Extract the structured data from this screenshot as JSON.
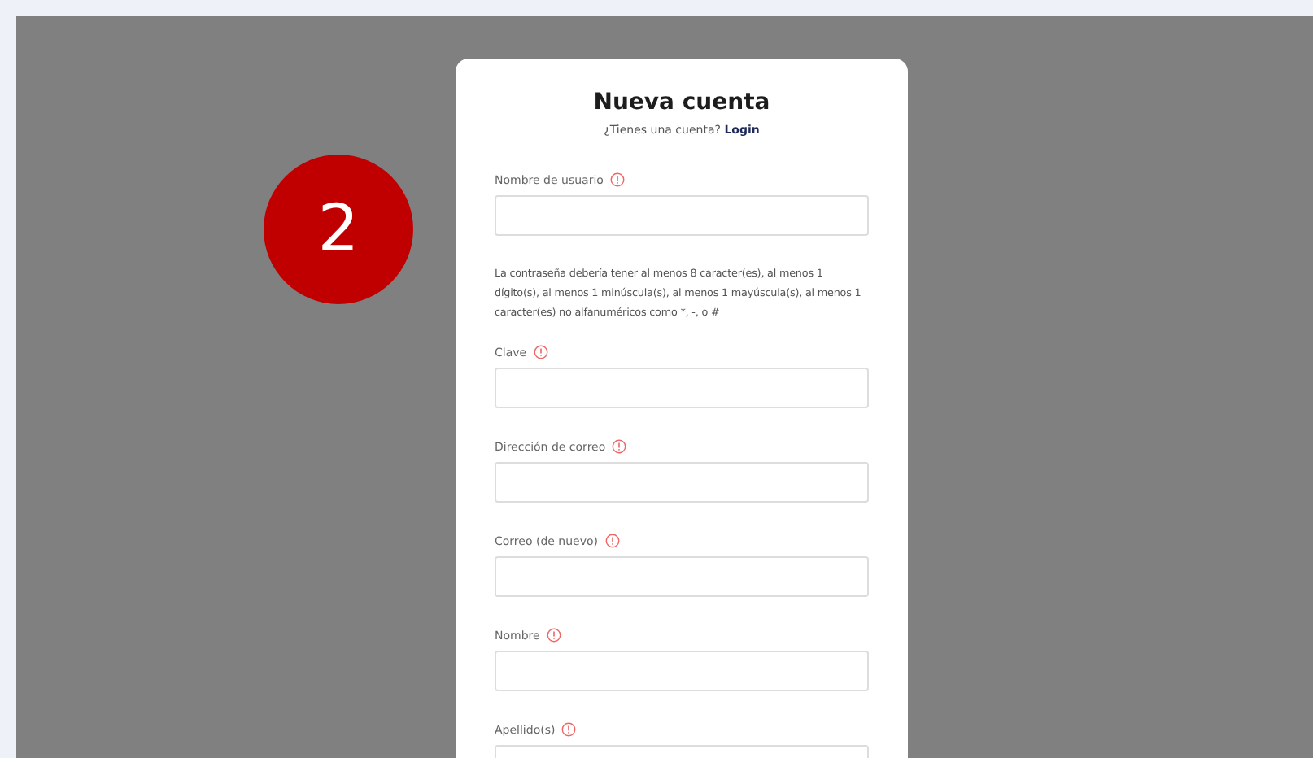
{
  "step_badge": "2",
  "form": {
    "title": "Nueva cuenta",
    "subtitle": "¿Tienes una cuenta?",
    "login_link": "Login",
    "fields": [
      {
        "label": "Nombre de usuario",
        "required": true
      },
      {
        "help": "La contraseña debería tener al menos 8 caracter(es), al menos 1 dígito(s), al menos 1 minúscula(s), al menos 1 mayúscula(s), al menos 1 caracter(es) no alfanuméricos como *, -, o #",
        "label": "Clave",
        "required": true
      },
      {
        "label": "Dirección de correo",
        "required": true
      },
      {
        "label": "Correo (de nuevo)",
        "required": true
      },
      {
        "label": "Nombre",
        "required": true
      },
      {
        "label": "Apellido(s)",
        "required": true
      }
    ]
  }
}
